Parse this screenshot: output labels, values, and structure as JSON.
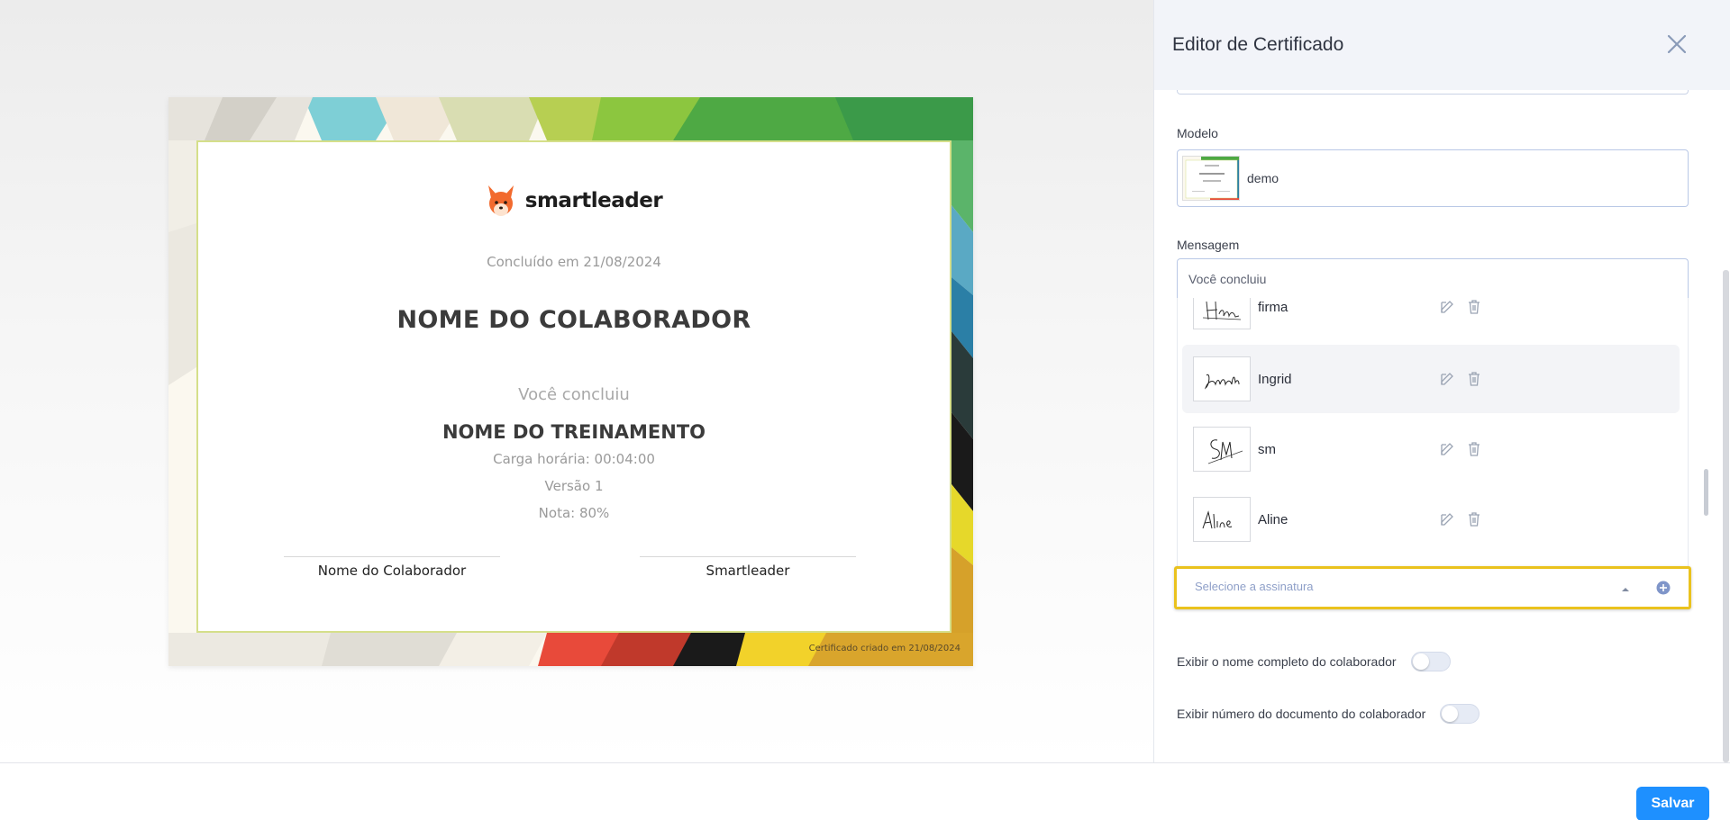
{
  "panel": {
    "title": "Editor de Certificado",
    "model": {
      "label": "Modelo",
      "value": "demo"
    },
    "message": {
      "label": "Mensagem",
      "value": "Você concluiu"
    },
    "signatures": [
      {
        "name": "firma"
      },
      {
        "name": "Ingrid"
      },
      {
        "name": "sm"
      },
      {
        "name": "Aline"
      }
    ],
    "signature_select": {
      "placeholder": "Selecione a assinatura"
    },
    "toggles": [
      {
        "label": "Exibir o nome completo do colaborador",
        "checked": false
      },
      {
        "label": "Exibir número do documento do colaborador",
        "checked": false
      }
    ]
  },
  "certificate": {
    "brand": "smartleader",
    "completed": "Concluído em 21/08/2024",
    "employee_name": "NOME DO COLABORADOR",
    "message": "Você concluiu",
    "training_name": "NOME DO TREINAMENTO",
    "hours": "Carga horária: 00:04:00",
    "version": "Versão 1",
    "grade": "Nota: 80%",
    "signature_left": "Nome do Colaborador",
    "signature_right": "Smartleader",
    "footer": "Certificado criado em 21/08/2024"
  },
  "footer": {
    "save_label": "Salvar"
  },
  "colors": {
    "accent": "#1e90ff",
    "highlight_border": "#eac21e",
    "brand_orange": "#f26a2e"
  },
  "icons": [
    "close-icon",
    "edit-icon",
    "trash-icon",
    "caret-up-icon",
    "add-circle-icon",
    "fox-logo-icon"
  ]
}
